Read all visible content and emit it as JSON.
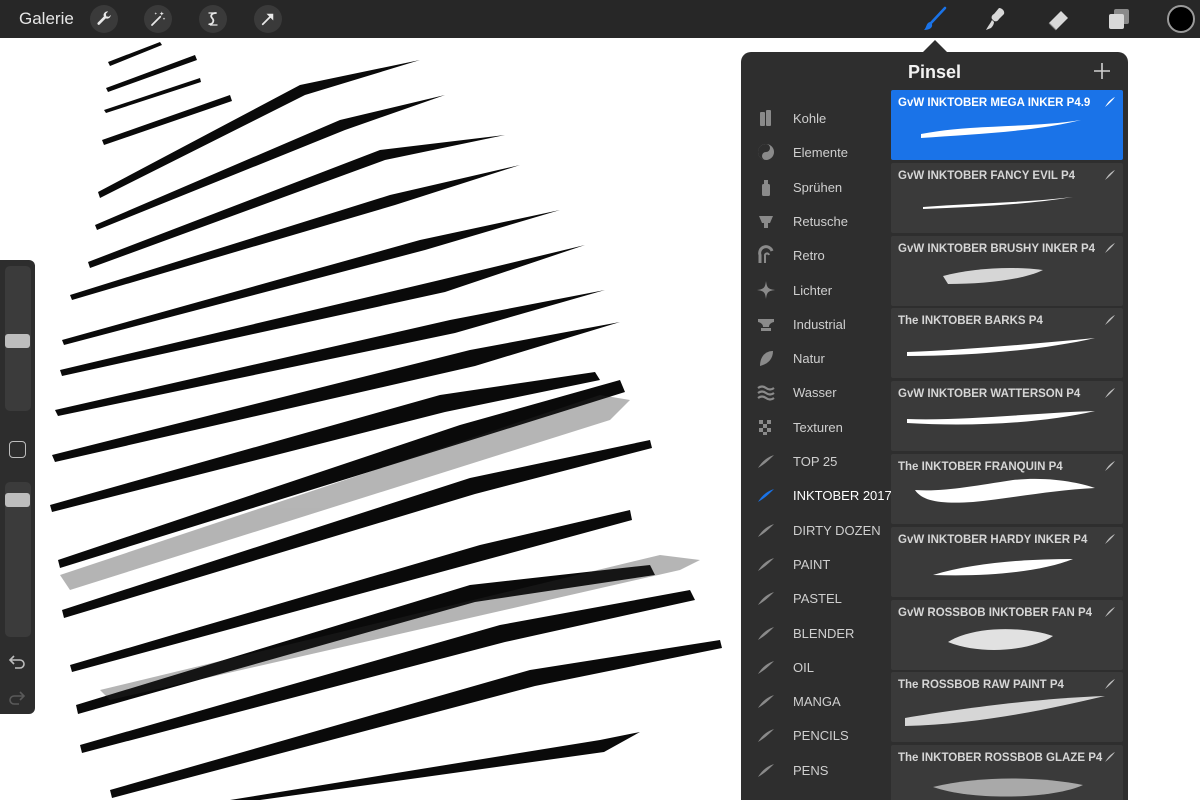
{
  "topbar": {
    "gallery_label": "Galerie",
    "actions": [
      "wrench-icon",
      "magic-wand-icon",
      "selection-icon",
      "transform-arrow-icon"
    ],
    "tools": [
      "brush-icon",
      "smudge-icon",
      "eraser-icon",
      "layers-icon"
    ],
    "active_tool": "brush",
    "current_color": "#000000"
  },
  "colors": {
    "accent": "#1a73e8",
    "panel_bg": "#2e2e2e",
    "card_bg": "#3a3a3a",
    "topbar_bg": "#272727"
  },
  "sidebar": {
    "brush_size_level": 0.48,
    "opacity_level": 0.05
  },
  "panel": {
    "title": "Pinsel",
    "add_icon": "plus-icon"
  },
  "brush_sets": [
    {
      "label": "Kohle",
      "icon": "charcoal-icon"
    },
    {
      "label": "Elemente",
      "icon": "yin-yang-icon"
    },
    {
      "label": "Sprühen",
      "icon": "spray-can-icon"
    },
    {
      "label": "Retusche",
      "icon": "airbrush-icon"
    },
    {
      "label": "Retro",
      "icon": "retro-icon"
    },
    {
      "label": "Lichter",
      "icon": "sparkle-icon"
    },
    {
      "label": "Industrial",
      "icon": "anvil-icon"
    },
    {
      "label": "Natur",
      "icon": "leaf-icon"
    },
    {
      "label": "Wasser",
      "icon": "waves-icon"
    },
    {
      "label": "Texturen",
      "icon": "checker-icon"
    },
    {
      "label": "TOP 25",
      "icon": "brush-stroke-icon"
    },
    {
      "label": "INKTOBER 2017",
      "icon": "brush-stroke-icon",
      "active": true
    },
    {
      "label": "DIRTY DOZEN",
      "icon": "brush-stroke-icon"
    },
    {
      "label": "PAINT",
      "icon": "brush-stroke-icon"
    },
    {
      "label": "PASTEL",
      "icon": "brush-stroke-icon"
    },
    {
      "label": "BLENDER",
      "icon": "brush-stroke-icon"
    },
    {
      "label": "OIL",
      "icon": "brush-stroke-icon"
    },
    {
      "label": "MANGA",
      "icon": "brush-stroke-icon"
    },
    {
      "label": "PENCILS",
      "icon": "brush-stroke-icon"
    },
    {
      "label": "PENS",
      "icon": "brush-stroke-icon"
    }
  ],
  "brushes": [
    {
      "name": "GvW INKTOBER MEGA INKER P4.9",
      "selected": true
    },
    {
      "name": "GvW INKTOBER FANCY EVIL P4"
    },
    {
      "name": "GvW INKTOBER BRUSHY INKER P4"
    },
    {
      "name": "The INKTOBER BARKS P4"
    },
    {
      "name": "GvW INKTOBER WATTERSON P4"
    },
    {
      "name": "The INKTOBER FRANQUIN P4"
    },
    {
      "name": "GvW INKTOBER HARDY INKER P4"
    },
    {
      "name": "GvW ROSSBOB INKTOBER FAN P4"
    },
    {
      "name": "The ROSSBOB RAW PAINT P4"
    },
    {
      "name": "The INKTOBER ROSSBOB GLAZE P4"
    }
  ]
}
